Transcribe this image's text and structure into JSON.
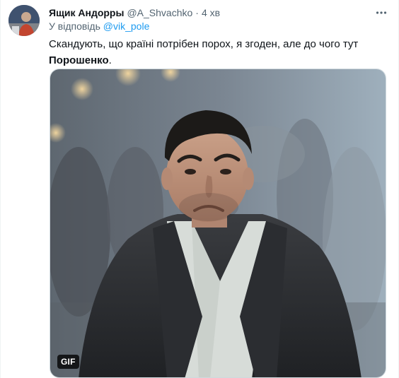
{
  "tweet": {
    "author": {
      "display_name": "Ящик Андорры",
      "handle": "@A_Shvachko",
      "separator": "·",
      "time": "4 хв",
      "avatar_icon": "profile-photo"
    },
    "reply": {
      "prefix": "У відповідь",
      "mention": "@vik_pole"
    },
    "text": {
      "main": "Скандують, що країні потрібен порох, я згоден, але до чого тут",
      "bold": "Порошенко",
      "end": "."
    },
    "media": {
      "badge": "GIF",
      "icon": "animated-gif-man-in-coat"
    },
    "more_icon": "ellipsis-icon"
  },
  "colors": {
    "text_primary": "#0f1419",
    "text_secondary": "#536471",
    "link": "#1d9bf0",
    "border": "#cfd9de"
  }
}
